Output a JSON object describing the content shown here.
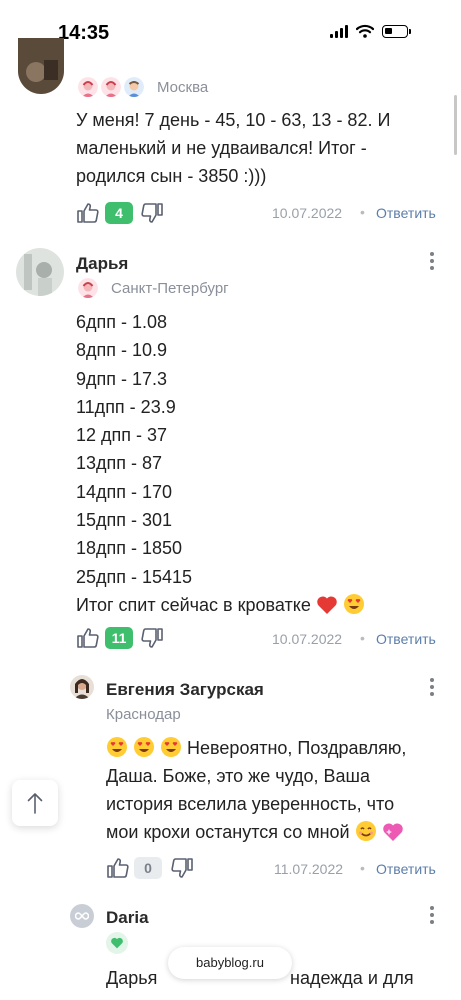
{
  "status_bar": {
    "time": "14:35",
    "icons": [
      "signal-icon",
      "wifi-icon",
      "battery-icon"
    ]
  },
  "comments": [
    {
      "city": "Москва",
      "badges": [
        "girl-avatar-icon",
        "girl-avatar-icon",
        "boy-avatar-icon"
      ],
      "text_lines": [
        "У меня! 7 день - 45, 10 - 63, 13 - 82. И",
        "маленький и не удваивался! Итог -",
        "родился сын - 3850 :)))"
      ],
      "likes": "4",
      "date": "10.07.2022",
      "reply_label": "Ответить"
    },
    {
      "name": "Дарья",
      "city": "Санкт-Петербург",
      "badges": [
        "girl-avatar-icon"
      ],
      "lines": [
        "6дпп - 1.08",
        "8дпп - 10.9",
        "9дпп - 17.3",
        "11дпп - 23.9",
        "12 дпп - 37",
        "13дпп - 87",
        "14дпп - 170",
        "15дпп - 301",
        "18дпп - 1850",
        "25дпп - 15415"
      ],
      "final_line": "Итог спит сейчас в кроватке",
      "final_emojis": [
        "red-heart-emoji",
        "heart-eyes-emoji"
      ],
      "likes": "11",
      "date": "10.07.2022",
      "reply_label": "Ответить"
    },
    {
      "name": "Евгения Загурская",
      "city": "Краснодар",
      "text_lines": [
        "Невероятно, Поздравляю,",
        "Даша. Боже, это же чудо, Ваша",
        "история вселила уверенность, что",
        "мои крохи останутся со мной"
      ],
      "emojis": [
        "heart-eyes-emoji",
        "heart-eyes-emoji",
        "heart-eyes-emoji",
        "smile-emoji",
        "sparkling-heart-emoji"
      ],
      "likes": "0",
      "date": "11.07.2022",
      "reply_label": "Ответить"
    },
    {
      "name": "Daria",
      "badge": "green-heart-badge-icon",
      "text_partial": "Дарья",
      "text_partial_right": "надежда и для"
    }
  ],
  "floating": {
    "source": "babyblog.ru",
    "scroll_up_icon": "arrow-up-icon"
  },
  "colors": {
    "like_green": "#3fbf6e",
    "link_blue": "#5c7eaa",
    "muted": "#8a8f99"
  }
}
